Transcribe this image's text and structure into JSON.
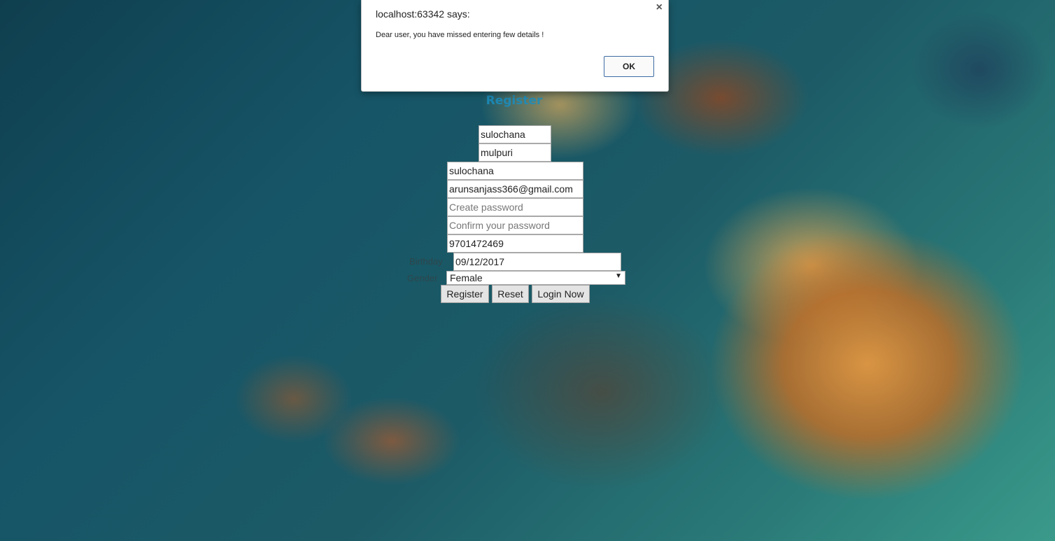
{
  "dialog": {
    "title": "localhost:63342 says:",
    "message": "Dear user, you have missed entering few details !",
    "ok_label": "OK",
    "close_glyph": "×"
  },
  "form": {
    "title": "Register",
    "first_name": "sulochana",
    "last_name": "mulpuri",
    "username": "sulochana",
    "email": "arunsanjass366@gmail.com",
    "password_placeholder": "Create password",
    "confirm_password_placeholder": "Confirm your password",
    "phone": "9701472469",
    "dob_label": "Birthday",
    "dob": "09/12/2017",
    "gender_label": "Gender",
    "gender": "Female",
    "register_label": "Register",
    "reset_label": "Reset",
    "login_label": "Login Now"
  },
  "icons": {
    "dropdown": "chevron-down-icon",
    "close": "close-icon"
  }
}
